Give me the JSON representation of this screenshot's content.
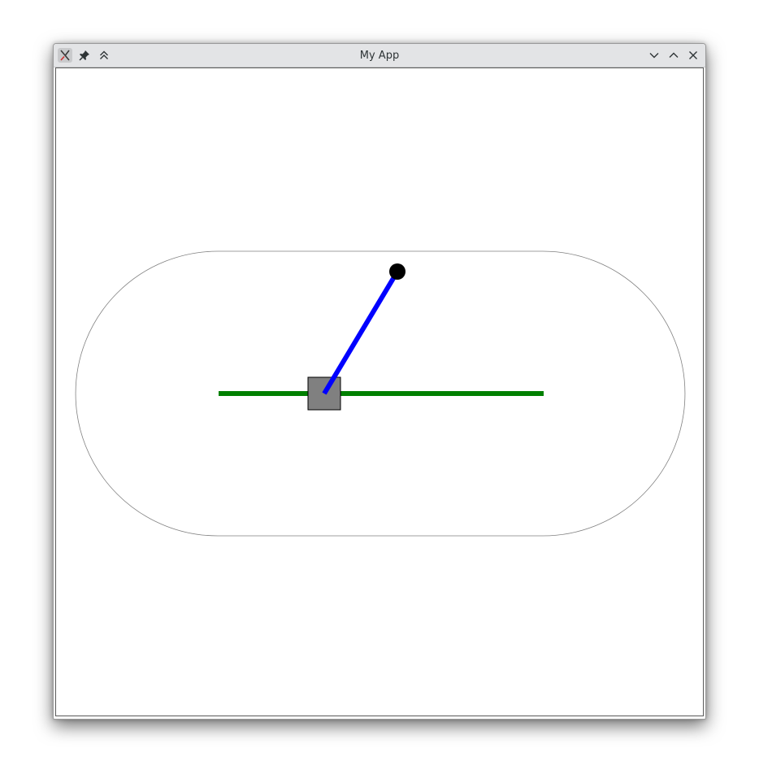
{
  "window": {
    "title": "My App"
  },
  "titlebar": {
    "left_buttons": [
      {
        "name": "app-menu",
        "icon": "app-logo-icon"
      },
      {
        "name": "pin",
        "icon": "pin-icon"
      },
      {
        "name": "keep-above",
        "icon": "double-chevron-up-icon"
      }
    ],
    "right_buttons": [
      {
        "name": "minimize",
        "icon": "chevron-down-icon"
      },
      {
        "name": "maximize",
        "icon": "chevron-up-icon"
      },
      {
        "name": "close",
        "icon": "close-icon"
      }
    ]
  },
  "scene": {
    "colors": {
      "track": "#808080",
      "rail": "#008000",
      "cart": "#808080",
      "pole": "#0000ff",
      "bob": "#000000"
    }
  }
}
